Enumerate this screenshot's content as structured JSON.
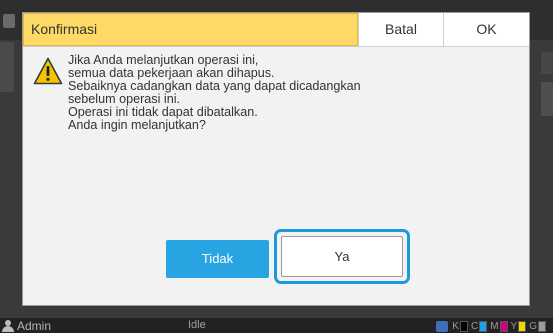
{
  "dialog": {
    "title": "Konfirmasi",
    "header_buttons": {
      "cancel": "Batal",
      "ok": "OK"
    },
    "icon": "warning-triangle-icon",
    "message_lines": [
      "Jika Anda melanjutkan operasi ini,",
      "semua data pekerjaan akan dihapus.",
      "Sebaiknya cadangkan data yang dapat dicadangkan",
      "sebelum operasi ini.",
      "Operasi ini tidak dapat dibatalkan.",
      "Anda ingin melanjutkan?"
    ],
    "buttons": {
      "no": "Tidak",
      "yes": "Ya"
    },
    "colors": {
      "title_bg": "#ffd966",
      "primary_button": "#27a4e1",
      "focus_outline": "#1b9ad8"
    }
  },
  "status_bar": {
    "user": "Admin",
    "user_icon": "user-icon",
    "state": "Idle",
    "ink_icon": "ink-cartridge-icon",
    "inks": [
      {
        "letter": "K",
        "color": "#000000"
      },
      {
        "letter": "C",
        "color": "#1aa3e8"
      },
      {
        "letter": "M",
        "color": "#d6007e"
      },
      {
        "letter": "Y",
        "color": "#f2d600"
      },
      {
        "letter": "G",
        "color": "#9a9a9a"
      }
    ]
  }
}
